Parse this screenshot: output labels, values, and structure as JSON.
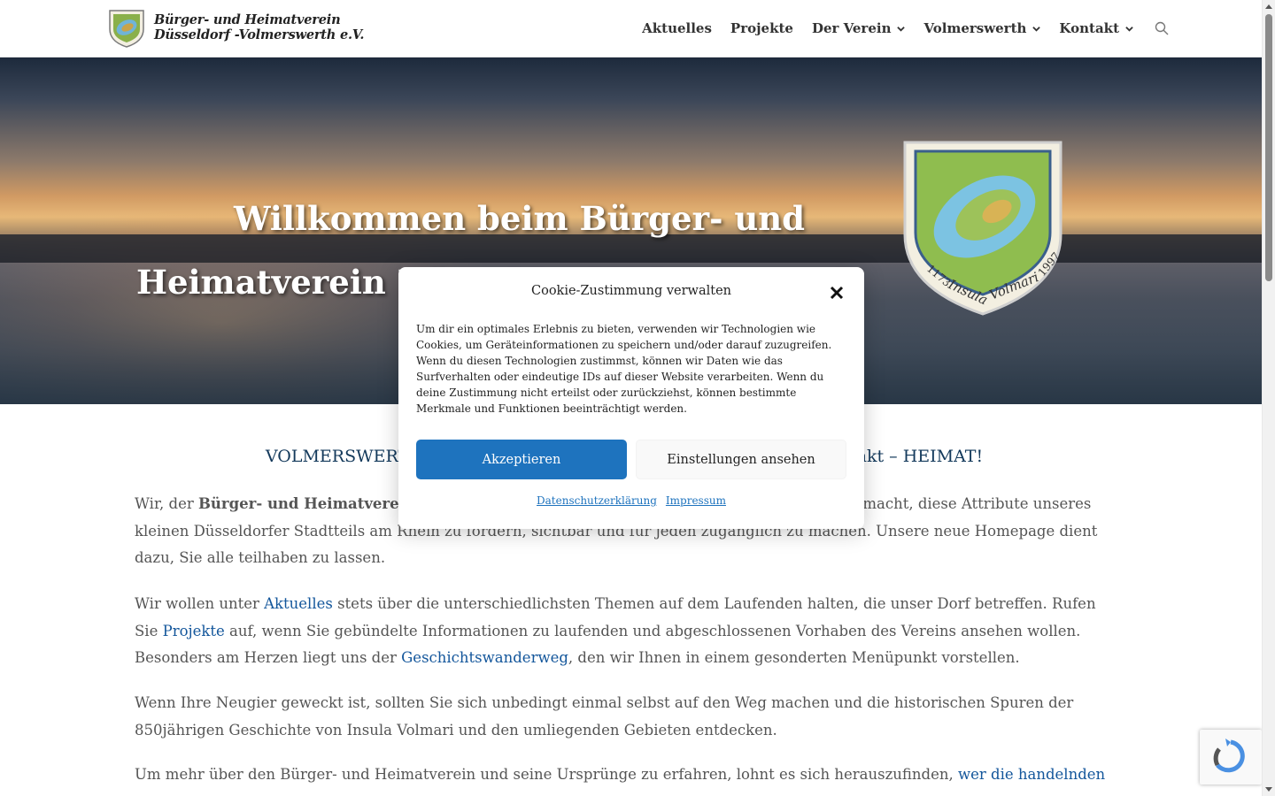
{
  "brand": {
    "line1": "Bürger- und Heimatverein",
    "line2": "Düsseldorf -Volmerswerth e.V."
  },
  "nav": {
    "items": [
      {
        "label": "Aktuelles",
        "dropdown": false
      },
      {
        "label": "Projekte",
        "dropdown": false
      },
      {
        "label": "Der Verein",
        "dropdown": true
      },
      {
        "label": "Volmerswerth",
        "dropdown": true
      },
      {
        "label": "Kontakt",
        "dropdown": true
      }
    ],
    "search_icon": "search-icon"
  },
  "hero": {
    "title_line1": "Willkommen beim Bürger- und",
    "title_line2": "Heimatverein Düsseldorf-Volmerswerth",
    "crest": {
      "ring_text_left": "1173",
      "ring_text_center": "Insula",
      "ring_text_right": "Volmari",
      "ring_text_year": "1997"
    }
  },
  "content": {
    "tagline": "VOLMERSWERTH – Dorf am Rhein – Gemeinschaft – Lebensmittelpunkt – HEIMAT!",
    "p1": {
      "pre": "Wir, der ",
      "bold": "Bürger- und Heimatverein Düsseldorf-Volmerswerth e.V.",
      "post": ", haben uns zur Aufgabe gemacht, diese Attribute unseres kleinen Düsseldorfer Stadtteils am Rhein zu fördern, sichtbar und für jeden zugänglich zu machen. Unsere neue Homepage dient dazu, Sie alle teilhaben zu lassen."
    },
    "p2": {
      "t1": "Wir wollen unter ",
      "link1": "Aktuelles",
      "t2": " stets über die unterschiedlichsten Themen auf dem Laufenden halten, die unser Dorf betreffen. Rufen Sie ",
      "link2": "Projekte",
      "t3": " auf, wenn Sie gebündelte Informationen zu laufenden und abgeschlossenen Vorhaben des Vereins ansehen wollen. Besonders am Herzen liegt uns der ",
      "link3": "Geschichtswanderweg",
      "t4": ", den wir Ihnen in einem gesonderten Menüpunkt vorstellen."
    },
    "p3": "Wenn Ihre Neugier geweckt ist, sollten Sie sich unbedingt einmal selbst auf den Weg machen und die historischen Spuren der 850jährigen Geschichte von Insula Volmari und den umliegenden Gebieten entdecken.",
    "p4": {
      "t1": "Um mehr über den Bürger- und Heimatverein und seine Ursprünge zu erfahren, lohnt es sich herauszufinden, ",
      "link": "wer die handelnden"
    }
  },
  "cookie_modal": {
    "title": "Cookie-Zustimmung verwalten",
    "body": "Um dir ein optimales Erlebnis zu bieten, verwenden wir Technologien wie Cookies, um Geräteinformationen zu speichern und/oder darauf zuzugreifen. Wenn du diesen Technologien zustimmst, können wir Daten wie das Surfverhalten oder eindeutige IDs auf dieser Website verarbeiten. Wenn du deine Zustimmung nicht erteilst oder zurückziehst, können bestimmte Merkmale und Funktionen beeinträchtigt werden.",
    "accept_label": "Akzeptieren",
    "settings_label": "Einstellungen ansehen",
    "link_privacy": "Datenschutzerklärung",
    "link_imprint": "Impressum"
  },
  "colors": {
    "accent": "#1e73be",
    "link": "#13569b",
    "tagline": "#13395b",
    "text": "#555555"
  }
}
